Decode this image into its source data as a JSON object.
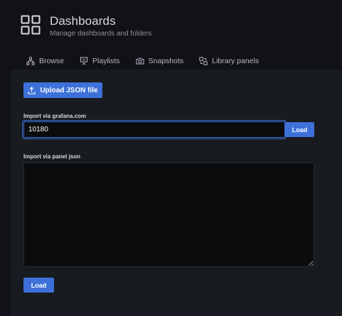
{
  "header": {
    "title": "Dashboards",
    "subtitle": "Manage dashboards and folders",
    "icon": "apps-grid-icon"
  },
  "tabs": [
    {
      "label": "Browse",
      "icon": "sitemap-icon"
    },
    {
      "label": "Playlists",
      "icon": "presentation-icon"
    },
    {
      "label": "Snapshots",
      "icon": "camera-icon"
    },
    {
      "label": "Library panels",
      "icon": "library-panel-icon"
    }
  ],
  "import": {
    "upload_label": "Upload JSON file",
    "grafana_label": "Import via grafana.com",
    "grafana_value": "10180",
    "grafana_load": "Load",
    "json_label": "Import via panel json",
    "json_value": "",
    "json_load": "Load"
  },
  "colors": {
    "accent": "#3d71d9",
    "background": "#111217",
    "panel": "#181b1f",
    "input_bg": "#0b0c0e"
  }
}
